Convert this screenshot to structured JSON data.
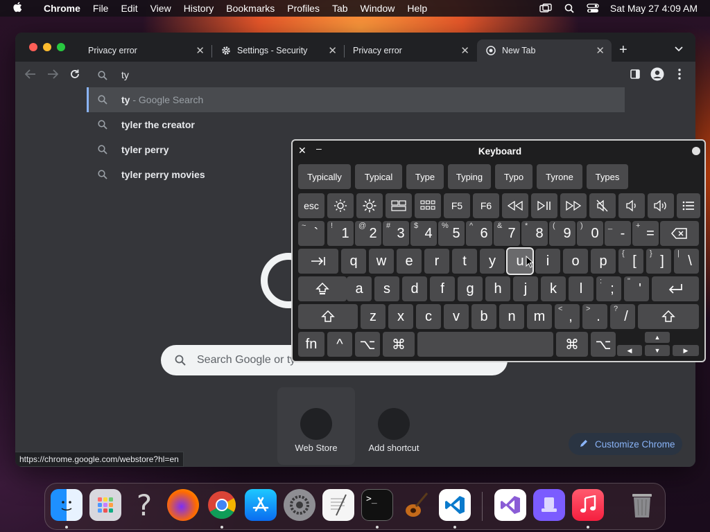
{
  "menubar": {
    "app_name": "Chrome",
    "items": [
      "File",
      "Edit",
      "View",
      "History",
      "Bookmarks",
      "Profiles",
      "Tab",
      "Window",
      "Help"
    ],
    "clock": "Sat May 27  4:09 AM"
  },
  "tabs": [
    {
      "title": "Privacy error",
      "active": false
    },
    {
      "title": "Settings - Security",
      "active": false
    },
    {
      "title": "Privacy error",
      "active": false
    },
    {
      "title": "New Tab",
      "active": true
    }
  ],
  "omnibox": {
    "query": "ty",
    "suggestions": [
      {
        "typed": "ty",
        "rest": " - Google Search",
        "selected": true
      },
      {
        "text": "tyler the creator"
      },
      {
        "text": "tyler perry"
      },
      {
        "text": "tyler perry movies"
      }
    ]
  },
  "ntp": {
    "search_placeholder": "Search Google or ty",
    "shortcuts": [
      "Web Store",
      "Add shortcut"
    ],
    "customize_label": "Customize Chrome",
    "status_url": "https://chrome.google.com/webstore?hl=en"
  },
  "keyboard": {
    "title": "Keyboard",
    "suggestions": [
      "Typically",
      "Typical",
      "Type",
      "Typing",
      "Typo",
      "Tyrone",
      "Types"
    ],
    "row_fn": {
      "esc": "esc",
      "f5": "F5",
      "f6": "F6"
    },
    "row_num": [
      {
        "main": "`",
        "sub": "~"
      },
      {
        "main": "1",
        "sub": "!"
      },
      {
        "main": "2",
        "sub": "@"
      },
      {
        "main": "3",
        "sub": "#"
      },
      {
        "main": "4",
        "sub": "$"
      },
      {
        "main": "5",
        "sub": "%"
      },
      {
        "main": "6",
        "sub": "^"
      },
      {
        "main": "7",
        "sub": "&"
      },
      {
        "main": "8",
        "sub": "*"
      },
      {
        "main": "9",
        "sub": "("
      },
      {
        "main": "0",
        "sub": ")"
      },
      {
        "main": "-",
        "sub": "_"
      },
      {
        "main": "=",
        "sub": "+"
      }
    ],
    "row_q": [
      "q",
      "w",
      "e",
      "r",
      "t",
      "y",
      "u",
      "i",
      "o",
      "p"
    ],
    "row_q_punct": [
      {
        "main": "[",
        "sub": "{"
      },
      {
        "main": "]",
        "sub": "}"
      },
      {
        "main": "\\",
        "sub": "|"
      }
    ],
    "row_a": [
      "a",
      "s",
      "d",
      "f",
      "g",
      "h",
      "j",
      "k",
      "l"
    ],
    "row_a_punct": [
      {
        "main": ";",
        "sub": ":"
      },
      {
        "main": "'",
        "sub": "\""
      }
    ],
    "row_z": [
      "z",
      "x",
      "c",
      "v",
      "b",
      "n",
      "m"
    ],
    "row_z_punct": [
      {
        "main": ",",
        "sub": "<"
      },
      {
        "main": ".",
        "sub": ">"
      },
      {
        "main": "/",
        "sub": "?"
      }
    ],
    "bottom": {
      "fn": "fn",
      "ctrl": "^",
      "opt": "⌥",
      "cmd": "⌘"
    },
    "highlighted_key": "u"
  },
  "dock": {
    "apps": [
      "finder-icon",
      "launchpad-icon",
      "help-icon",
      "firefox-icon",
      "chrome-icon",
      "app-store-icon",
      "system-settings-icon",
      "textedit-icon",
      "terminal-icon",
      "garageband-icon",
      "vscode-icon",
      "visual-studio-icon",
      "apple-configurator-icon",
      "music-icon",
      "trash-icon"
    ]
  },
  "colors": {
    "accent": "#8ab4f8",
    "window_bg": "#35363a",
    "tabstrip_bg": "#202124",
    "keyboard_bg": "#1e1e1f",
    "key_bg": "#4a4a4c"
  }
}
